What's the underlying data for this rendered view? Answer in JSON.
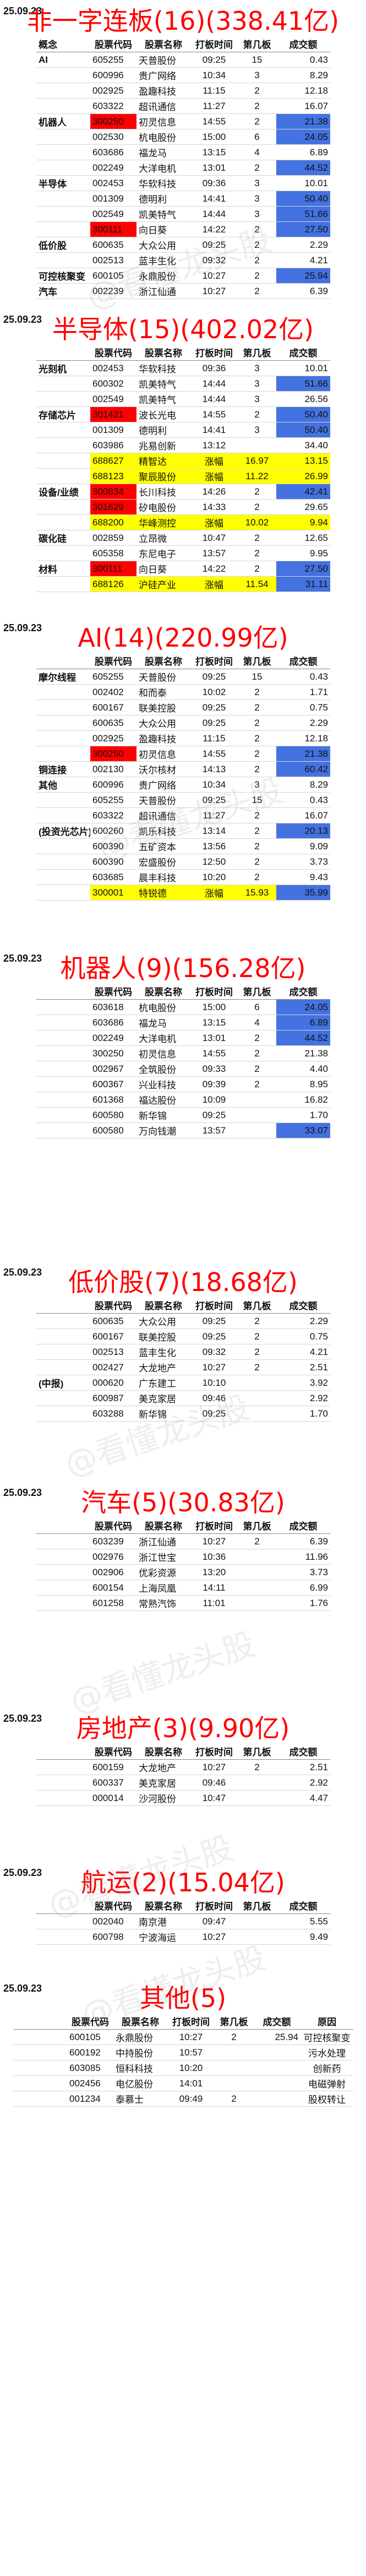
{
  "watermark": "@看懂龙头股",
  "columns": {
    "code": "股票代码",
    "name": "股票名称",
    "time": "打板时间",
    "board": "第几板",
    "amount": "成交额"
  },
  "sections": [
    {
      "date": "25.09.23",
      "title": "非一字连板(16)(338.41亿)",
      "cat_header": "概念",
      "rows": [
        {
          "cat": "AI",
          "code": "605255",
          "name": "天普股份",
          "time": "09:25",
          "board": "15",
          "amount": "0.43"
        },
        {
          "cat": "",
          "code": "600996",
          "name": "贵广网络",
          "time": "10:34",
          "board": "3",
          "amount": "8.29"
        },
        {
          "cat": "",
          "code": "002925",
          "name": "盈趣科技",
          "time": "11:15",
          "board": "2",
          "amount": "12.18"
        },
        {
          "cat": "",
          "code": "603322",
          "name": "超讯通信",
          "time": "11:27",
          "board": "2",
          "amount": "16.07"
        },
        {
          "cat": "机器人",
          "code": "300250",
          "name": "初灵信息",
          "time": "14:55",
          "board": "2",
          "amount": "21.38",
          "hl": "red",
          "blue": true
        },
        {
          "cat": "",
          "code": "002530",
          "name": "杭电股份",
          "time": "15:00",
          "board": "6",
          "amount": "24.05",
          "blue": true
        },
        {
          "cat": "",
          "code": "603686",
          "name": "福龙马",
          "time": "13:15",
          "board": "4",
          "amount": "6.89"
        },
        {
          "cat": "",
          "code": "002249",
          "name": "大洋电机",
          "time": "13:01",
          "board": "2",
          "amount": "44.52",
          "blue": true
        },
        {
          "cat": "半导体",
          "code": "002453",
          "name": "华软科技",
          "time": "09:36",
          "board": "3",
          "amount": "10.01",
          "orange": true
        },
        {
          "cat": "",
          "code": "001309",
          "name": "德明利",
          "time": "14:41",
          "board": "3",
          "amount": "50.40",
          "orange": true,
          "blue": true
        },
        {
          "cat": "",
          "code": "002549",
          "name": "凯美特气",
          "time": "14:44",
          "board": "3",
          "amount": "51.66",
          "blue": true
        },
        {
          "cat": "",
          "code": "300111",
          "name": "向日葵",
          "time": "14:22",
          "board": "2",
          "amount": "27.50",
          "hl": "red",
          "blue": true
        },
        {
          "cat": "低价股",
          "code": "600635",
          "name": "大众公用",
          "time": "09:25",
          "board": "2",
          "amount": "2.29"
        },
        {
          "cat": "",
          "code": "002513",
          "name": "蓝丰生化",
          "time": "09:32",
          "board": "2",
          "amount": "4.21"
        },
        {
          "cat": "可控核聚变",
          "code": "600105",
          "name": "永鼎股份",
          "time": "10:27",
          "board": "2",
          "amount": "25.94",
          "blue": true
        },
        {
          "cat": "汽车",
          "code": "002239",
          "name": "浙江仙通",
          "time": "10:27",
          "board": "2",
          "amount": "6.39"
        }
      ]
    },
    {
      "date": "25.09.23",
      "title": "半导体(15)(402.02亿)",
      "cat_header": "",
      "rows": [
        {
          "cat": "光刻机",
          "code": "002453",
          "name": "华软科技",
          "time": "09:36",
          "board": "3",
          "amount": "10.01",
          "orange": true
        },
        {
          "cat": "",
          "code": "600302",
          "name": "凯美特气",
          "time": "14:44",
          "board": "3",
          "amount": "51.66",
          "blue": true
        },
        {
          "cat": "",
          "code": "002549",
          "name": "凯美特气",
          "time": "14:44",
          "board": "3",
          "amount": "26.56"
        },
        {
          "cat": "存储芯片",
          "code": "301421",
          "name": "波长光电",
          "time": "14:55",
          "board": "2",
          "amount": "50.40",
          "hl": "red",
          "blue": true
        },
        {
          "cat": "",
          "code": "001309",
          "name": "德明利",
          "time": "14:41",
          "board": "3",
          "amount": "50.40",
          "orange": true,
          "blue": true
        },
        {
          "cat": "",
          "code": "603986",
          "name": "兆易创新",
          "time": "13:12",
          "board": "",
          "amount": "34.40"
        },
        {
          "cat": "",
          "code": "688627",
          "name": "精智达",
          "time": "涨幅",
          "board": "16.97",
          "amount": "13.15",
          "yellow": true
        },
        {
          "cat": "",
          "code": "688123",
          "name": "聚辰股份",
          "time": "涨幅",
          "board": "11.22",
          "amount": "26.99",
          "yellow": true
        },
        {
          "cat": "设备/业绩",
          "code": "300834",
          "name": "长川科技",
          "time": "14:26",
          "board": "2",
          "amount": "42.41",
          "hl": "red",
          "orange": true,
          "blue": true
        },
        {
          "cat": "",
          "code": "301629",
          "name": "矽电股份",
          "time": "14:33",
          "board": "2",
          "amount": "29.65",
          "hl": "red",
          "orange": true
        },
        {
          "cat": "",
          "code": "688200",
          "name": "华峰测控",
          "time": "涨幅",
          "board": "10.02",
          "amount": "9.94",
          "yellow": true
        },
        {
          "cat": "碳化硅",
          "code": "002859",
          "name": "立昂微",
          "time": "10:47",
          "board": "2",
          "amount": "12.65",
          "orange": true
        },
        {
          "cat": "",
          "code": "605358",
          "name": "东尼电子",
          "time": "13:57",
          "board": "2",
          "amount": "9.95"
        },
        {
          "cat": "材料",
          "code": "300111",
          "name": "向日葵",
          "time": "14:22",
          "board": "2",
          "amount": "27.50",
          "hl": "red",
          "orange": true,
          "blue": true
        },
        {
          "cat": "",
          "code": "688126",
          "name": "沪硅产业",
          "time": "涨幅",
          "board": "11.54",
          "amount": "31.11",
          "yellow": true,
          "blue": true
        }
      ]
    },
    {
      "date": "25.09.23",
      "title": "AI(14)(220.99亿)",
      "cat_header": "",
      "rows": [
        {
          "cat": "摩尔线程",
          "code": "605255",
          "name": "天普股份",
          "time": "09:25",
          "board": "15",
          "amount": "0.43"
        },
        {
          "cat": "",
          "code": "002402",
          "name": "和而泰",
          "time": "10:02",
          "board": "2",
          "amount": "1.71",
          "orange": true
        },
        {
          "cat": "",
          "code": "600167",
          "name": "联美控股",
          "time": "09:25",
          "board": "2",
          "amount": "0.75"
        },
        {
          "cat": "",
          "code": "600635",
          "name": "大众公用",
          "time": "09:25",
          "board": "2",
          "amount": "2.29"
        },
        {
          "cat": "",
          "code": "002925",
          "name": "盈趣科技",
          "time": "11:15",
          "board": "2",
          "amount": "12.18"
        },
        {
          "cat": "",
          "code": "300250",
          "name": "初灵信息",
          "time": "14:55",
          "board": "2",
          "amount": "21.38",
          "hl": "red",
          "blue": true
        },
        {
          "cat": "铜连接",
          "code": "002130",
          "name": "沃尔核材",
          "time": "14:13",
          "board": "2",
          "amount": "60.42",
          "blue": true
        },
        {
          "cat": "其他",
          "code": "600996",
          "name": "贵广网络",
          "time": "10:34",
          "board": "3",
          "amount": "8.29"
        },
        {
          "cat": "",
          "code": "605255",
          "name": "天普股份",
          "time": "09:25",
          "board": "15",
          "amount": "0.43"
        },
        {
          "cat": "",
          "code": "603322",
          "name": "超讯通信",
          "time": "11:27",
          "board": "2",
          "amount": "16.07"
        },
        {
          "cat": "(投资光芯片)",
          "code": "600260",
          "name": "凯乐科技",
          "time": "13:14",
          "board": "2",
          "amount": "20.13",
          "blue": true
        },
        {
          "cat": "",
          "code": "600390",
          "name": "五矿资本",
          "time": "13:56",
          "board": "2",
          "amount": "9.09"
        },
        {
          "cat": "",
          "code": "600390",
          "name": "宏盛股份",
          "time": "12:50",
          "board": "2",
          "amount": "3.73"
        },
        {
          "cat": "",
          "code": "603685",
          "name": "晨丰科技",
          "time": "10:20",
          "board": "2",
          "amount": "9.43"
        },
        {
          "cat": "",
          "code": "300001",
          "name": "特锐德",
          "time": "涨幅",
          "board": "15.93",
          "amount": "35.99",
          "yellow": true,
          "blue": true
        }
      ]
    },
    {
      "date": "25.09.23",
      "title": "机器人(9)(156.28亿)",
      "cat_header": "",
      "rows": [
        {
          "cat": "",
          "code": "603618",
          "name": "杭电股份",
          "time": "15:00",
          "board": "6",
          "amount": "24.05",
          "orange": true,
          "blue": true
        },
        {
          "cat": "",
          "code": "603686",
          "name": "福龙马",
          "time": "13:15",
          "board": "4",
          "amount": "6.89",
          "blue": true
        },
        {
          "cat": "",
          "code": "002249",
          "name": "大洋电机",
          "time": "13:01",
          "board": "2",
          "amount": "44.52",
          "blue": true
        },
        {
          "cat": "",
          "code": "300250",
          "name": "初灵信息",
          "time": "14:55",
          "board": "2",
          "amount": "21.38",
          "orange": true
        },
        {
          "cat": "",
          "code": "002967",
          "name": "全筑股份",
          "time": "09:33",
          "board": "2",
          "amount": "4.40"
        },
        {
          "cat": "",
          "code": "600367",
          "name": "兴业科技",
          "time": "09:39",
          "board": "2",
          "amount": "8.95"
        },
        {
          "cat": "",
          "code": "601368",
          "name": "福达股份",
          "time": "10:09",
          "board": "",
          "amount": "16.82"
        },
        {
          "cat": "",
          "code": "600580",
          "name": "新华锦",
          "time": "09:25",
          "board": "",
          "amount": "1.70"
        },
        {
          "cat": "",
          "code": "600580",
          "name": "万向钱潮",
          "time": "13:57",
          "board": "",
          "amount": "33.07",
          "blue": true
        }
      ]
    },
    {
      "date": "25.09.23",
      "title": "低价股(7)(18.68亿)",
      "cat_header": "",
      "rows": [
        {
          "cat": "",
          "code": "600635",
          "name": "大众公用",
          "time": "09:25",
          "board": "2",
          "amount": "2.29",
          "orange": true
        },
        {
          "cat": "",
          "code": "600167",
          "name": "联美控股",
          "time": "09:25",
          "board": "2",
          "amount": "0.75"
        },
        {
          "cat": "",
          "code": "002513",
          "name": "蓝丰生化",
          "time": "09:32",
          "board": "2",
          "amount": "4.21"
        },
        {
          "cat": "",
          "code": "002427",
          "name": "大龙地产",
          "time": "10:27",
          "board": "2",
          "amount": "2.51"
        },
        {
          "cat": "(中报)",
          "code": "000620",
          "name": "广东建工",
          "time": "10:10",
          "board": "",
          "amount": "3.92"
        },
        {
          "cat": "",
          "code": "600987",
          "name": "美克家居",
          "time": "09:46",
          "board": "",
          "amount": "2.92"
        },
        {
          "cat": "",
          "code": "603288",
          "name": "新华锦",
          "time": "09:25",
          "board": "",
          "amount": "1.70"
        }
      ]
    },
    {
      "date": "25.09.23",
      "title": "汽车(5)(30.83亿)",
      "cat_header": "",
      "rows": [
        {
          "cat": "",
          "code": "603239",
          "name": "浙江仙通",
          "time": "10:27",
          "board": "2",
          "amount": "6.39",
          "orange": true
        },
        {
          "cat": "",
          "code": "002976",
          "name": "浙江世宝",
          "time": "10:36",
          "board": "",
          "amount": "11.96"
        },
        {
          "cat": "",
          "code": "002906",
          "name": "优彩资源",
          "time": "13:20",
          "board": "",
          "amount": "3.73"
        },
        {
          "cat": "",
          "code": "600154",
          "name": "上海凤凰",
          "time": "14:11",
          "board": "",
          "amount": "6.99"
        },
        {
          "cat": "",
          "code": "601258",
          "name": "常熟汽饰",
          "time": "11:01",
          "board": "",
          "amount": "1.76"
        }
      ]
    },
    {
      "date": "25.09.23",
      "title": "房地产(3)(9.90亿)",
      "cat_header": "",
      "rows": [
        {
          "cat": "",
          "code": "600159",
          "name": "大龙地产",
          "time": "10:27",
          "board": "2",
          "amount": "2.51",
          "orange": true
        },
        {
          "cat": "",
          "code": "600337",
          "name": "美克家居",
          "time": "09:46",
          "board": "",
          "amount": "2.92"
        },
        {
          "cat": "",
          "code": "000014",
          "name": "沙河股份",
          "time": "10:47",
          "board": "",
          "amount": "4.47"
        }
      ]
    },
    {
      "date": "25.09.23",
      "title": "航运(2)(15.04亿)",
      "cat_header": "",
      "rows": [
        {
          "cat": "",
          "code": "002040",
          "name": "南京港",
          "time": "09:47",
          "board": "",
          "amount": "5.55",
          "orange": true
        },
        {
          "cat": "",
          "code": "600798",
          "name": "宁波海运",
          "time": "10:27",
          "board": "",
          "amount": "9.49"
        }
      ]
    },
    {
      "date": "25.09.23",
      "title": "其他(5)",
      "cat_header": "",
      "extra_header": "原因",
      "rows": [
        {
          "cat": "",
          "code": "600105",
          "name": "永鼎股份",
          "time": "10:27",
          "board": "2",
          "amount": "25.94",
          "reason": "可控核聚变"
        },
        {
          "cat": "",
          "code": "600192",
          "name": "中持股份",
          "time": "10:57",
          "board": "",
          "amount": "",
          "reason": "污水处理"
        },
        {
          "cat": "",
          "code": "603085",
          "name": "恒科科技",
          "time": "10:20",
          "board": "",
          "amount": "",
          "reason": "创新药"
        },
        {
          "cat": "",
          "code": "002456",
          "name": "电亿股份",
          "time": "14:01",
          "board": "",
          "amount": "",
          "reason": "电磁弹射"
        },
        {
          "cat": "",
          "code": "001234",
          "name": "泰慕士",
          "time": "09:49",
          "board": "2",
          "amount": "",
          "reason": "股权转让"
        }
      ]
    }
  ]
}
